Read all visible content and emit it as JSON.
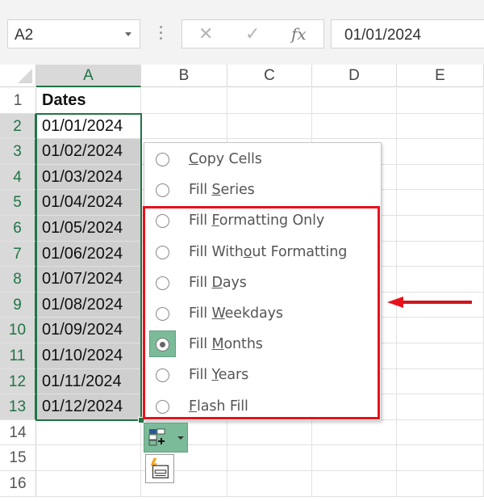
{
  "formula_bar": {
    "name_box": "A2",
    "cancel_icon": "✕",
    "enter_icon": "✓",
    "fx_label": "fx",
    "formula_value": "01/01/2024"
  },
  "columns": [
    "A",
    "B",
    "C",
    "D",
    "E"
  ],
  "selected_column": "A",
  "rows": [
    "1",
    "2",
    "3",
    "4",
    "5",
    "6",
    "7",
    "8",
    "9",
    "10",
    "11",
    "12",
    "13",
    "14",
    "15",
    "16"
  ],
  "cells": {
    "A1": "Dates",
    "A2": "01/01/2024",
    "A3": "01/02/2024",
    "A4": "01/03/2024",
    "A5": "01/04/2024",
    "A6": "01/05/2024",
    "A7": "01/06/2024",
    "A8": "01/07/2024",
    "A9": "01/08/2024",
    "A10": "01/09/2024",
    "A11": "01/10/2024",
    "A12": "01/11/2024",
    "A13": "01/12/2024"
  },
  "autofill_menu": {
    "items": [
      {
        "pre": "",
        "key": "C",
        "post": "opy Cells",
        "checked": false
      },
      {
        "pre": "Fill ",
        "key": "S",
        "post": "eries",
        "checked": false
      },
      {
        "pre": "Fill ",
        "key": "F",
        "post": "ormatting Only",
        "checked": false
      },
      {
        "pre": "Fill With",
        "key": "o",
        "post": "ut Formatting",
        "checked": false
      },
      {
        "pre": "Fill ",
        "key": "D",
        "post": "ays",
        "checked": false
      },
      {
        "pre": "Fill ",
        "key": "W",
        "post": "eekdays",
        "checked": false
      },
      {
        "pre": "Fill ",
        "key": "M",
        "post": "onths",
        "checked": true
      },
      {
        "pre": "Fill ",
        "key": "Y",
        "post": "ears",
        "checked": false
      },
      {
        "pre": "",
        "key": "F",
        "post": "lash Fill",
        "checked": false
      }
    ],
    "selected": "Fill Months"
  },
  "annotation": {
    "highlight_color": "#e8111b",
    "arrow_icon": "left-arrow"
  },
  "colors": {
    "accent": "#217346",
    "selected_option_bg": "#7cbb9a"
  }
}
